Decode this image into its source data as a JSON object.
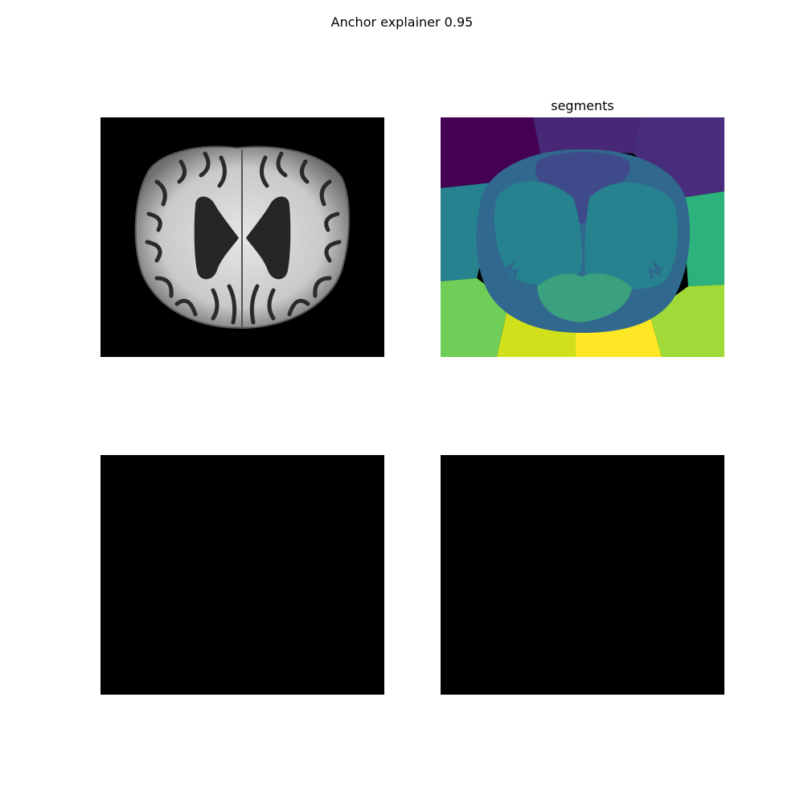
{
  "figure": {
    "title": "Anchor explainer 0.95"
  },
  "panels": {
    "segments_title": "segments"
  },
  "colors": {
    "background": "#000000",
    "seg_purple_dark": "#440154",
    "seg_purple": "#482777",
    "seg_indigo": "#3e4a89",
    "seg_blue": "#31688e",
    "seg_teal": "#26828e",
    "seg_green_teal": "#1f9e89",
    "seg_green": "#35b779",
    "seg_lime": "#6ece58",
    "seg_yellow_green": "#b5de2b",
    "seg_yellow": "#fde725"
  }
}
